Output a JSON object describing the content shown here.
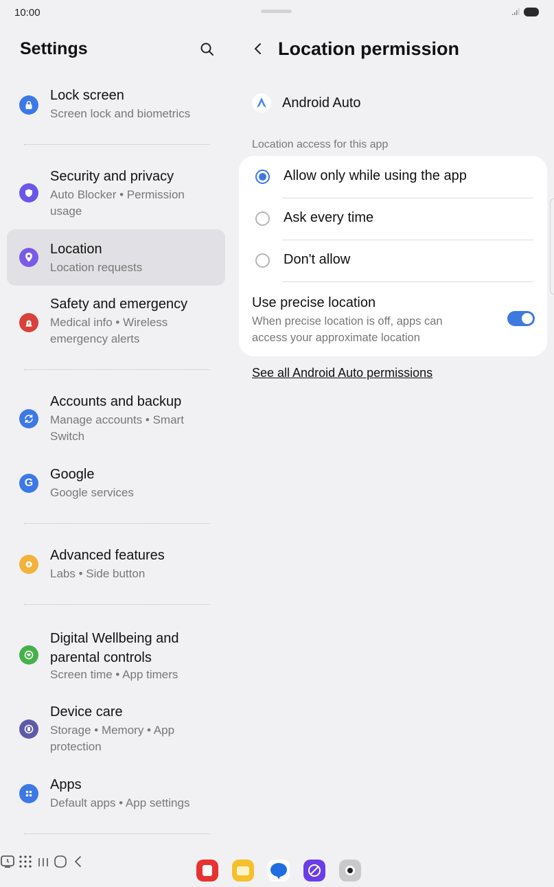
{
  "status_bar": {
    "time": "10:00"
  },
  "settings": {
    "title": "Settings",
    "items": [
      {
        "title": "Lock screen",
        "subtitle": "Screen lock and biometrics",
        "icon": "lock-icon",
        "color": "#3c78e6"
      },
      {
        "title": "Security and privacy",
        "subtitle": "Auto Blocker  •  Permission usage",
        "icon": "shield-icon",
        "color": "#6a57e8"
      },
      {
        "title": "Location",
        "subtitle": "Location requests",
        "icon": "location-pin-icon",
        "color": "#7a5ae8"
      },
      {
        "title": "Safety and emergency",
        "subtitle": "Medical info  •  Wireless emergency alerts",
        "icon": "siren-icon",
        "color": "#d9423a"
      },
      {
        "title": "Accounts and backup",
        "subtitle": "Manage accounts  •  Smart Switch",
        "icon": "sync-icon",
        "color": "#3c78e6"
      },
      {
        "title": "Google",
        "subtitle": "Google services",
        "icon": "google-icon",
        "color": "#3c78e6"
      },
      {
        "title": "Advanced features",
        "subtitle": "Labs  •  Side button",
        "icon": "star-gear-icon",
        "color": "#f4b23c"
      },
      {
        "title": "Digital Wellbeing and parental controls",
        "subtitle": "Screen time  •  App timers",
        "icon": "heart-circle-icon",
        "color": "#45b14a"
      },
      {
        "title": "Device care",
        "subtitle": "Storage  •  Memory  •  App protection",
        "icon": "device-care-icon",
        "color": "#5e5aa8"
      },
      {
        "title": "Apps",
        "subtitle": "Default apps  •  App settings",
        "icon": "apps-grid-icon",
        "color": "#3c78e6"
      }
    ]
  },
  "permission": {
    "title": "Location permission",
    "app_name": "Android Auto",
    "section_header": "Location access for this app",
    "options": [
      {
        "label": "Allow only while using the app",
        "selected": true
      },
      {
        "label": "Ask every time",
        "selected": false
      },
      {
        "label": "Don't allow",
        "selected": false
      }
    ],
    "precise": {
      "title": "Use precise location",
      "description": "When precise location is off, apps can access your approximate location",
      "enabled": true
    },
    "link": "See all Android Auto permissions"
  },
  "accent": "#3e79df"
}
